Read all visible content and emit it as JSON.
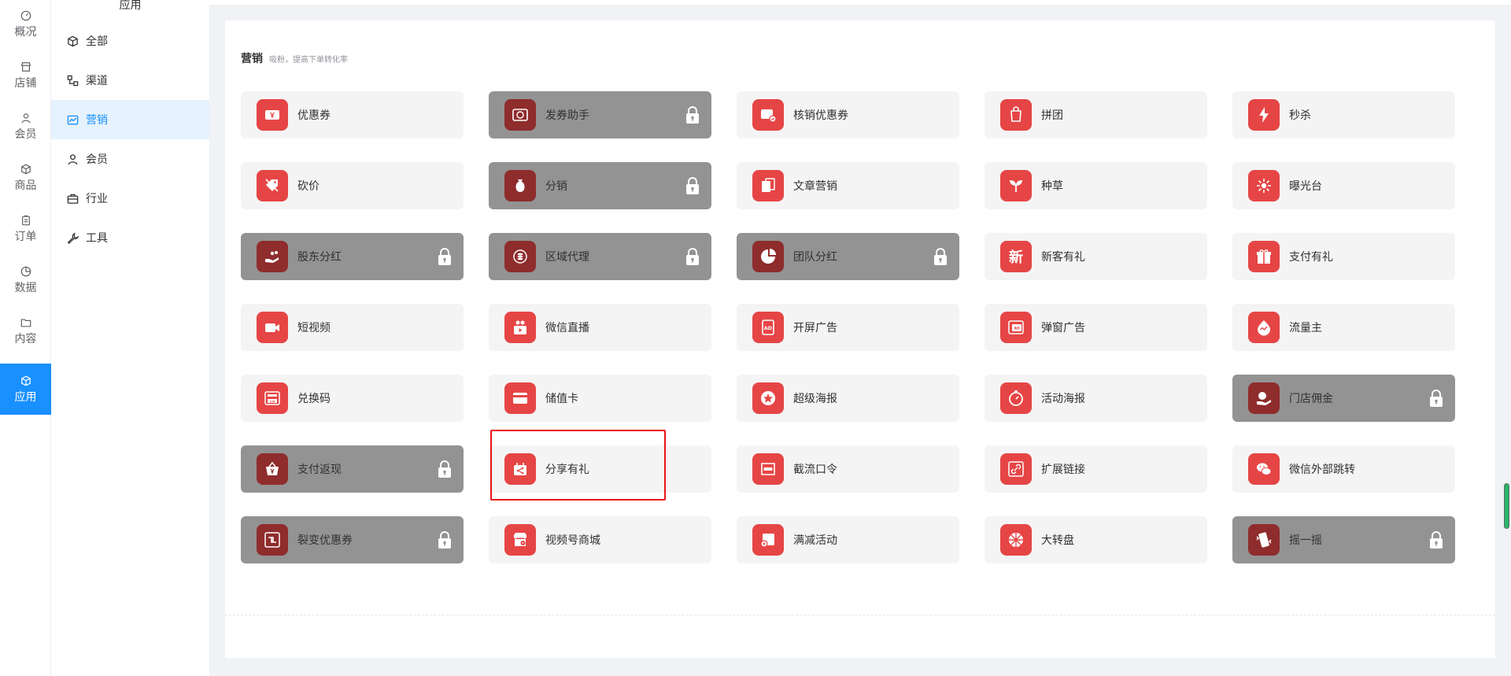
{
  "rail": [
    {
      "label": "概况",
      "icon": "dashboard-icon"
    },
    {
      "label": "店铺",
      "icon": "store-icon"
    },
    {
      "label": "会员",
      "icon": "user-icon"
    },
    {
      "label": "商品",
      "icon": "cube-icon"
    },
    {
      "label": "订单",
      "icon": "clipboard-icon"
    },
    {
      "label": "数据",
      "icon": "pie-icon"
    },
    {
      "label": "内容",
      "icon": "folder-icon"
    },
    {
      "label": "应用",
      "icon": "app-icon",
      "active": true
    }
  ],
  "subnav": {
    "title": "应用",
    "items": [
      {
        "label": "全部",
        "icon": "cube-icon"
      },
      {
        "label": "渠道",
        "icon": "channel-icon"
      },
      {
        "label": "营销",
        "icon": "chart-line-icon",
        "active": true
      },
      {
        "label": "会员",
        "icon": "user-icon"
      },
      {
        "label": "行业",
        "icon": "briefcase-icon"
      },
      {
        "label": "工具",
        "icon": "wrench-icon"
      }
    ]
  },
  "section": {
    "title": "营销",
    "subtitle": "吸粉，提高下单转化率"
  },
  "colors": {
    "accent": "#1890ff",
    "icon_red": "#e64545",
    "icon_dark_red": "#8f2c2c",
    "card_bg": "#f4f4f5",
    "card_locked_bg": "#939393",
    "highlight": "#e8141a"
  },
  "cards": [
    {
      "label": "优惠券",
      "icon": "coupon-icon",
      "locked": false
    },
    {
      "label": "发券助手",
      "icon": "coupon-helper-icon",
      "locked": true
    },
    {
      "label": "核销优惠券",
      "icon": "coupon-verify-icon",
      "locked": false
    },
    {
      "label": "拼团",
      "icon": "group-buy-icon",
      "locked": false
    },
    {
      "label": "秒杀",
      "icon": "lightning-icon",
      "locked": false
    },
    {
      "label": "砍价",
      "icon": "bargain-tag-icon",
      "locked": false
    },
    {
      "label": "分销",
      "icon": "money-bag-icon",
      "locked": true
    },
    {
      "label": "文章营销",
      "icon": "article-icon",
      "locked": false
    },
    {
      "label": "种草",
      "icon": "sprout-icon",
      "locked": false
    },
    {
      "label": "曝光台",
      "icon": "sparkle-icon",
      "locked": false
    },
    {
      "label": "股东分红",
      "icon": "hand-coins-icon",
      "locked": true
    },
    {
      "label": "区域代理",
      "icon": "coin-stack-icon",
      "locked": true
    },
    {
      "label": "团队分红",
      "icon": "pie-chart-icon",
      "locked": true
    },
    {
      "label": "新客有礼",
      "icon": "new-char-icon",
      "locked": false
    },
    {
      "label": "支付有礼",
      "icon": "gift-icon",
      "locked": false
    },
    {
      "label": "短视频",
      "icon": "video-camera-icon",
      "locked": false
    },
    {
      "label": "微信直播",
      "icon": "live-stream-icon",
      "locked": false
    },
    {
      "label": "开屏广告",
      "icon": "splash-ad-icon",
      "locked": false
    },
    {
      "label": "弹窗广告",
      "icon": "popup-ad-icon",
      "locked": false
    },
    {
      "label": "流量主",
      "icon": "traffic-drop-icon",
      "locked": false
    },
    {
      "label": "兑换码",
      "icon": "redeem-code-icon",
      "locked": false,
      "code_text": "兑换"
    },
    {
      "label": "储值卡",
      "icon": "card-icon",
      "locked": false
    },
    {
      "label": "超级海报",
      "icon": "star-badge-icon",
      "locked": false
    },
    {
      "label": "活动海报",
      "icon": "stopwatch-icon",
      "locked": false
    },
    {
      "label": "门店佣金",
      "icon": "hand-coin-icon",
      "locked": true
    },
    {
      "label": "支付返现",
      "icon": "cashback-icon",
      "locked": true
    },
    {
      "label": "分享有礼",
      "icon": "share-gift-icon",
      "locked": false
    },
    {
      "label": "截流口令",
      "icon": "password-icon",
      "locked": false
    },
    {
      "label": "扩展链接",
      "icon": "link-icon",
      "locked": false
    },
    {
      "label": "微信外部跳转",
      "icon": "wechat-icon",
      "locked": false
    },
    {
      "label": "裂变优惠券",
      "icon": "fission-coupon-icon",
      "locked": true
    },
    {
      "label": "视频号商城",
      "icon": "video-shop-icon",
      "locked": false
    },
    {
      "label": "满减活动",
      "icon": "discount-icon",
      "locked": false
    },
    {
      "label": "大转盘",
      "icon": "wheel-icon",
      "locked": false
    },
    {
      "label": "摇一摇",
      "icon": "shake-icon",
      "locked": true
    }
  ]
}
